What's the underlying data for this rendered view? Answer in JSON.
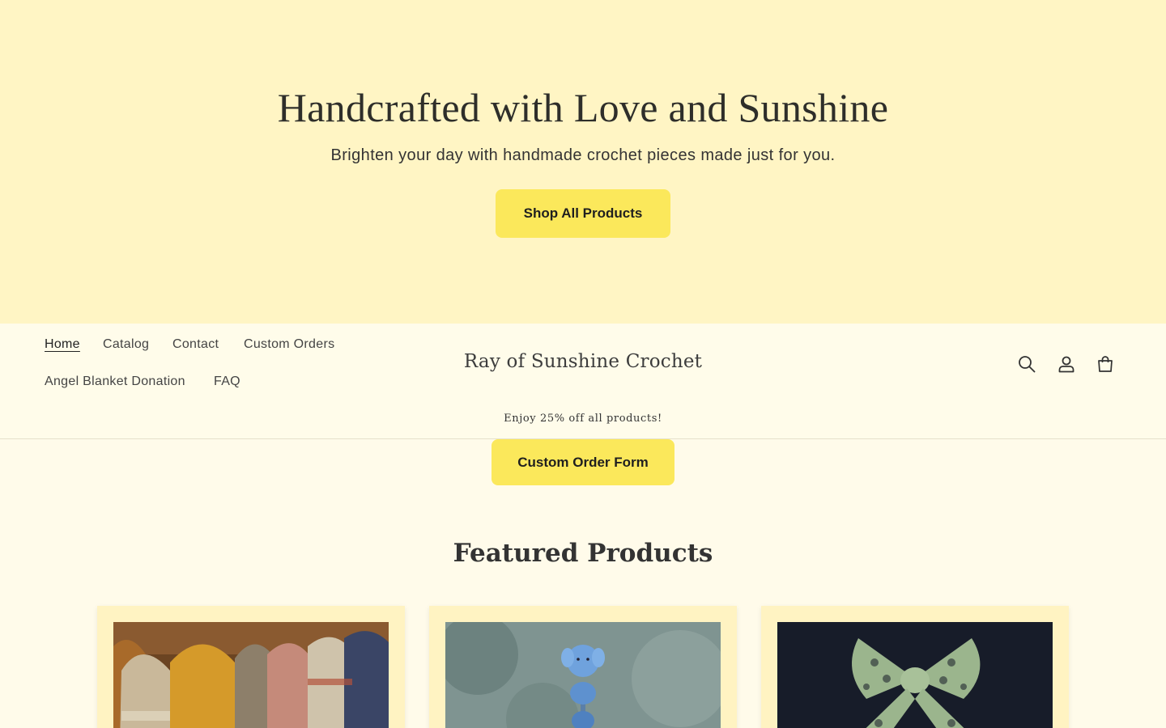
{
  "hero": {
    "title": "Handcrafted with Love and Sunshine",
    "subtitle": "Brighten your day with handmade crochet pieces made just for you.",
    "button_label": "Shop All Products"
  },
  "nav": {
    "items": [
      {
        "label": "Home",
        "active": true
      },
      {
        "label": "Catalog"
      },
      {
        "label": "Contact"
      },
      {
        "label": "Custom Orders"
      },
      {
        "label": "Angel Blanket Donation"
      },
      {
        "label": "FAQ"
      }
    ]
  },
  "brand": {
    "name": "Ray of Sunshine Crochet"
  },
  "icons": [
    "search-icon",
    "account-icon",
    "cart-icon"
  ],
  "announcement": {
    "text": "Enjoy 25% off all products!"
  },
  "custom_order": {
    "button_label": "Custom Order Form"
  },
  "featured": {
    "title": "Featured Products",
    "products": [
      {
        "image": "crochet bags photo"
      },
      {
        "image": "blue elephant bead figure photo"
      },
      {
        "image": "green crochet bow photo"
      }
    ]
  },
  "colors": {
    "hero_bg": "#fff5c4",
    "page_bg": "#fffbea",
    "button_bg": "#fbe85b",
    "card_bg": "#fff3c2"
  }
}
